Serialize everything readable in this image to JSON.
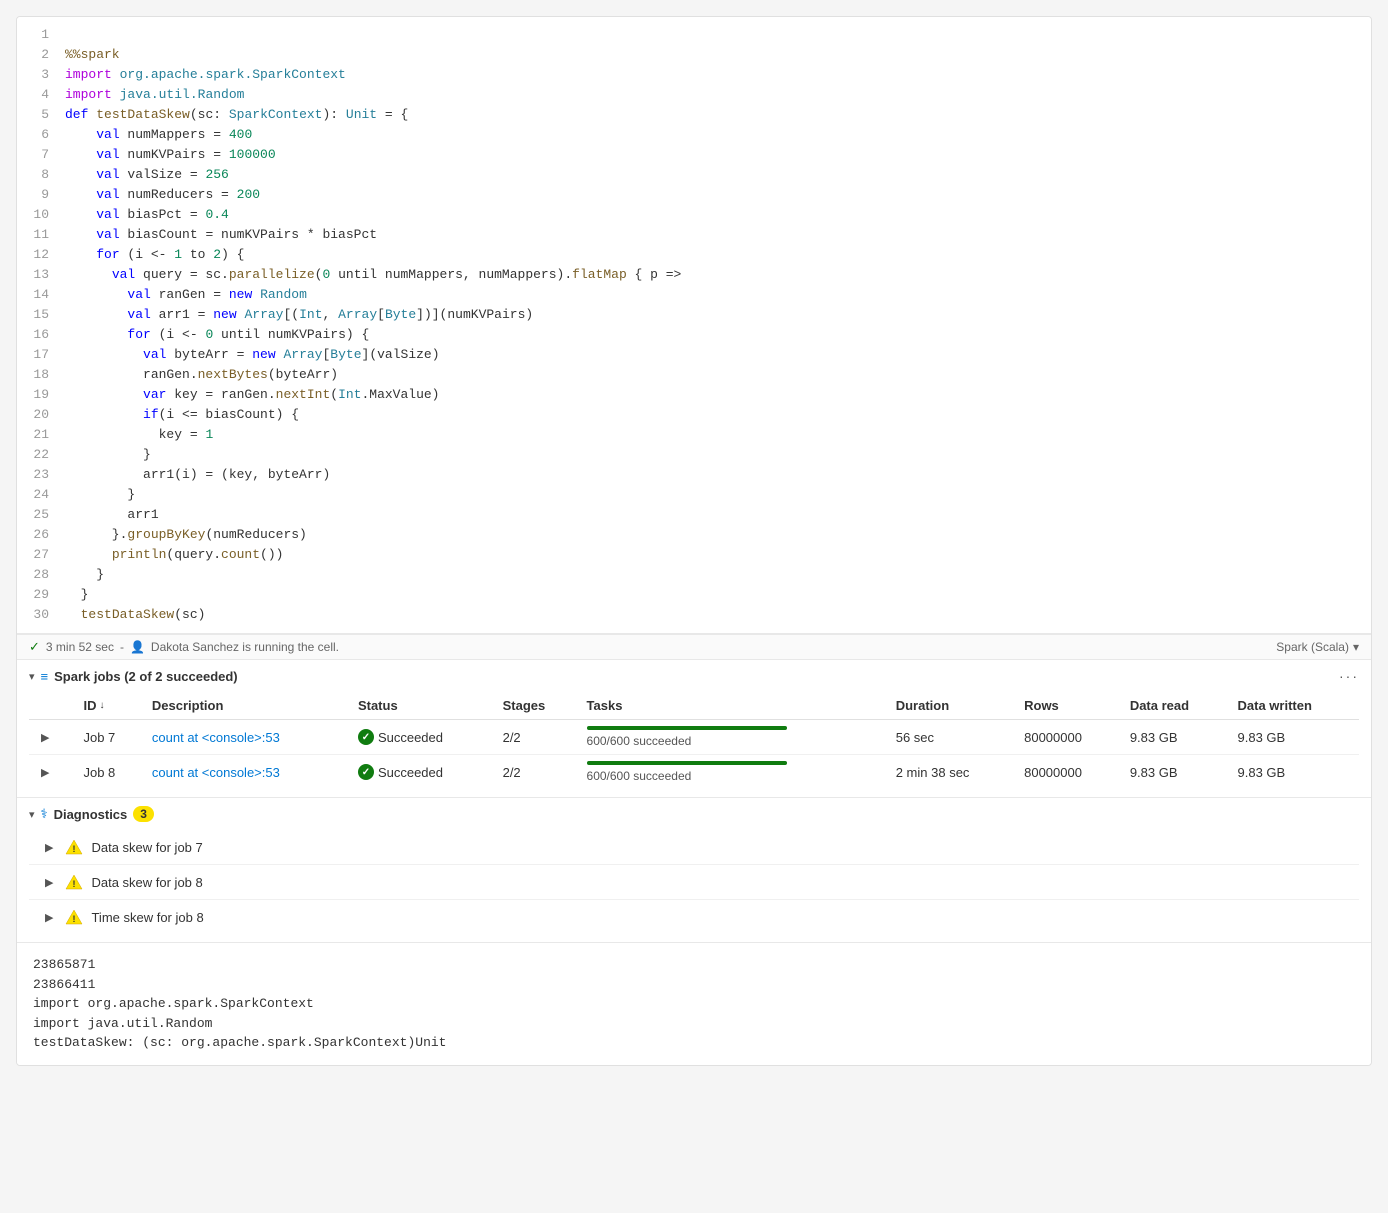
{
  "cell": {
    "lines": [
      {
        "num": 1,
        "code": ""
      },
      {
        "num": 2,
        "code": "%%spark",
        "type": "magic"
      },
      {
        "num": 3,
        "code": "import org.apache.spark.SparkContext",
        "type": "import"
      },
      {
        "num": 4,
        "code": "import java.util.Random",
        "type": "import"
      },
      {
        "num": 5,
        "code": "def testDataSkew(sc: SparkContext): Unit = {",
        "type": "code"
      },
      {
        "num": 6,
        "code": "    val numMappers = 400",
        "type": "code"
      },
      {
        "num": 7,
        "code": "    val numKVPairs = 100000",
        "type": "code"
      },
      {
        "num": 8,
        "code": "    val valSize = 256",
        "type": "code"
      },
      {
        "num": 9,
        "code": "    val numReducers = 200",
        "type": "code"
      },
      {
        "num": 10,
        "code": "    val biasPct = 0.4",
        "type": "code"
      },
      {
        "num": 11,
        "code": "    val biasCount = numKVPairs * biasPct",
        "type": "code"
      },
      {
        "num": 12,
        "code": "    for (i <- 1 to 2) {",
        "type": "code"
      },
      {
        "num": 13,
        "code": "      val query = sc.parallelize(0 until numMappers, numMappers).flatMap { p =>",
        "type": "code"
      },
      {
        "num": 14,
        "code": "        val ranGen = new Random",
        "type": "code"
      },
      {
        "num": 15,
        "code": "        val arr1 = new Array[(Int, Array[Byte])](numKVPairs)",
        "type": "code"
      },
      {
        "num": 16,
        "code": "        for (i <- 0 until numKVPairs) {",
        "type": "code"
      },
      {
        "num": 17,
        "code": "          val byteArr = new Array[Byte](valSize)",
        "type": "code"
      },
      {
        "num": 18,
        "code": "          ranGen.nextBytes(byteArr)",
        "type": "code"
      },
      {
        "num": 19,
        "code": "          var key = ranGen.nextInt(Int.MaxValue)",
        "type": "code"
      },
      {
        "num": 20,
        "code": "          if(i <= biasCount) {",
        "type": "code"
      },
      {
        "num": 21,
        "code": "            key = 1",
        "type": "code"
      },
      {
        "num": 22,
        "code": "          }",
        "type": "code"
      },
      {
        "num": 23,
        "code": "          arr1(i) = (key, byteArr)",
        "type": "code"
      },
      {
        "num": 24,
        "code": "        }",
        "type": "code"
      },
      {
        "num": 25,
        "code": "        arr1",
        "type": "code"
      },
      {
        "num": 26,
        "code": "      }.groupByKey(numReducers)",
        "type": "code"
      },
      {
        "num": 27,
        "code": "      println(query.count())",
        "type": "code"
      },
      {
        "num": 28,
        "code": "    }",
        "type": "code"
      },
      {
        "num": 29,
        "code": "  }",
        "type": "code"
      },
      {
        "num": 30,
        "code": "  testDataSkew(sc)",
        "type": "code"
      }
    ],
    "footer": {
      "timing": "3 min 52 sec",
      "user": "Dakota Sanchez is running the cell.",
      "kernel": "Spark (Scala)"
    }
  },
  "spark_jobs": {
    "title": "Spark jobs (2 of 2 succeeded)",
    "table": {
      "headers": [
        "",
        "ID",
        "Description",
        "Status",
        "Stages",
        "Tasks",
        "Duration",
        "Rows",
        "Data read",
        "Data written"
      ],
      "rows": [
        {
          "id": "Job 7",
          "description": "count at <console>:53",
          "status": "Succeeded",
          "stages": "2/2",
          "tasks": "600/600 succeeded",
          "progress": 100,
          "duration": "56 sec",
          "rows": "80000000",
          "data_read": "9.83 GB",
          "data_written": "9.83 GB"
        },
        {
          "id": "Job 8",
          "description": "count at <console>:53",
          "status": "Succeeded",
          "stages": "2/2",
          "tasks": "600/600 succeeded",
          "progress": 100,
          "duration": "2 min 38 sec",
          "rows": "80000000",
          "data_read": "9.83 GB",
          "data_written": "9.83 GB"
        }
      ]
    }
  },
  "diagnostics": {
    "title": "Diagnostics",
    "count": "3",
    "items": [
      {
        "label": "Data skew for job 7"
      },
      {
        "label": "Data skew for job 8"
      },
      {
        "label": "Time skew for job 8"
      }
    ]
  },
  "output": {
    "lines": [
      "23865871",
      "23866411",
      "import org.apache.spark.SparkContext",
      "import java.util.Random",
      "testDataSkew: (sc: org.apache.spark.SparkContext)Unit"
    ]
  }
}
